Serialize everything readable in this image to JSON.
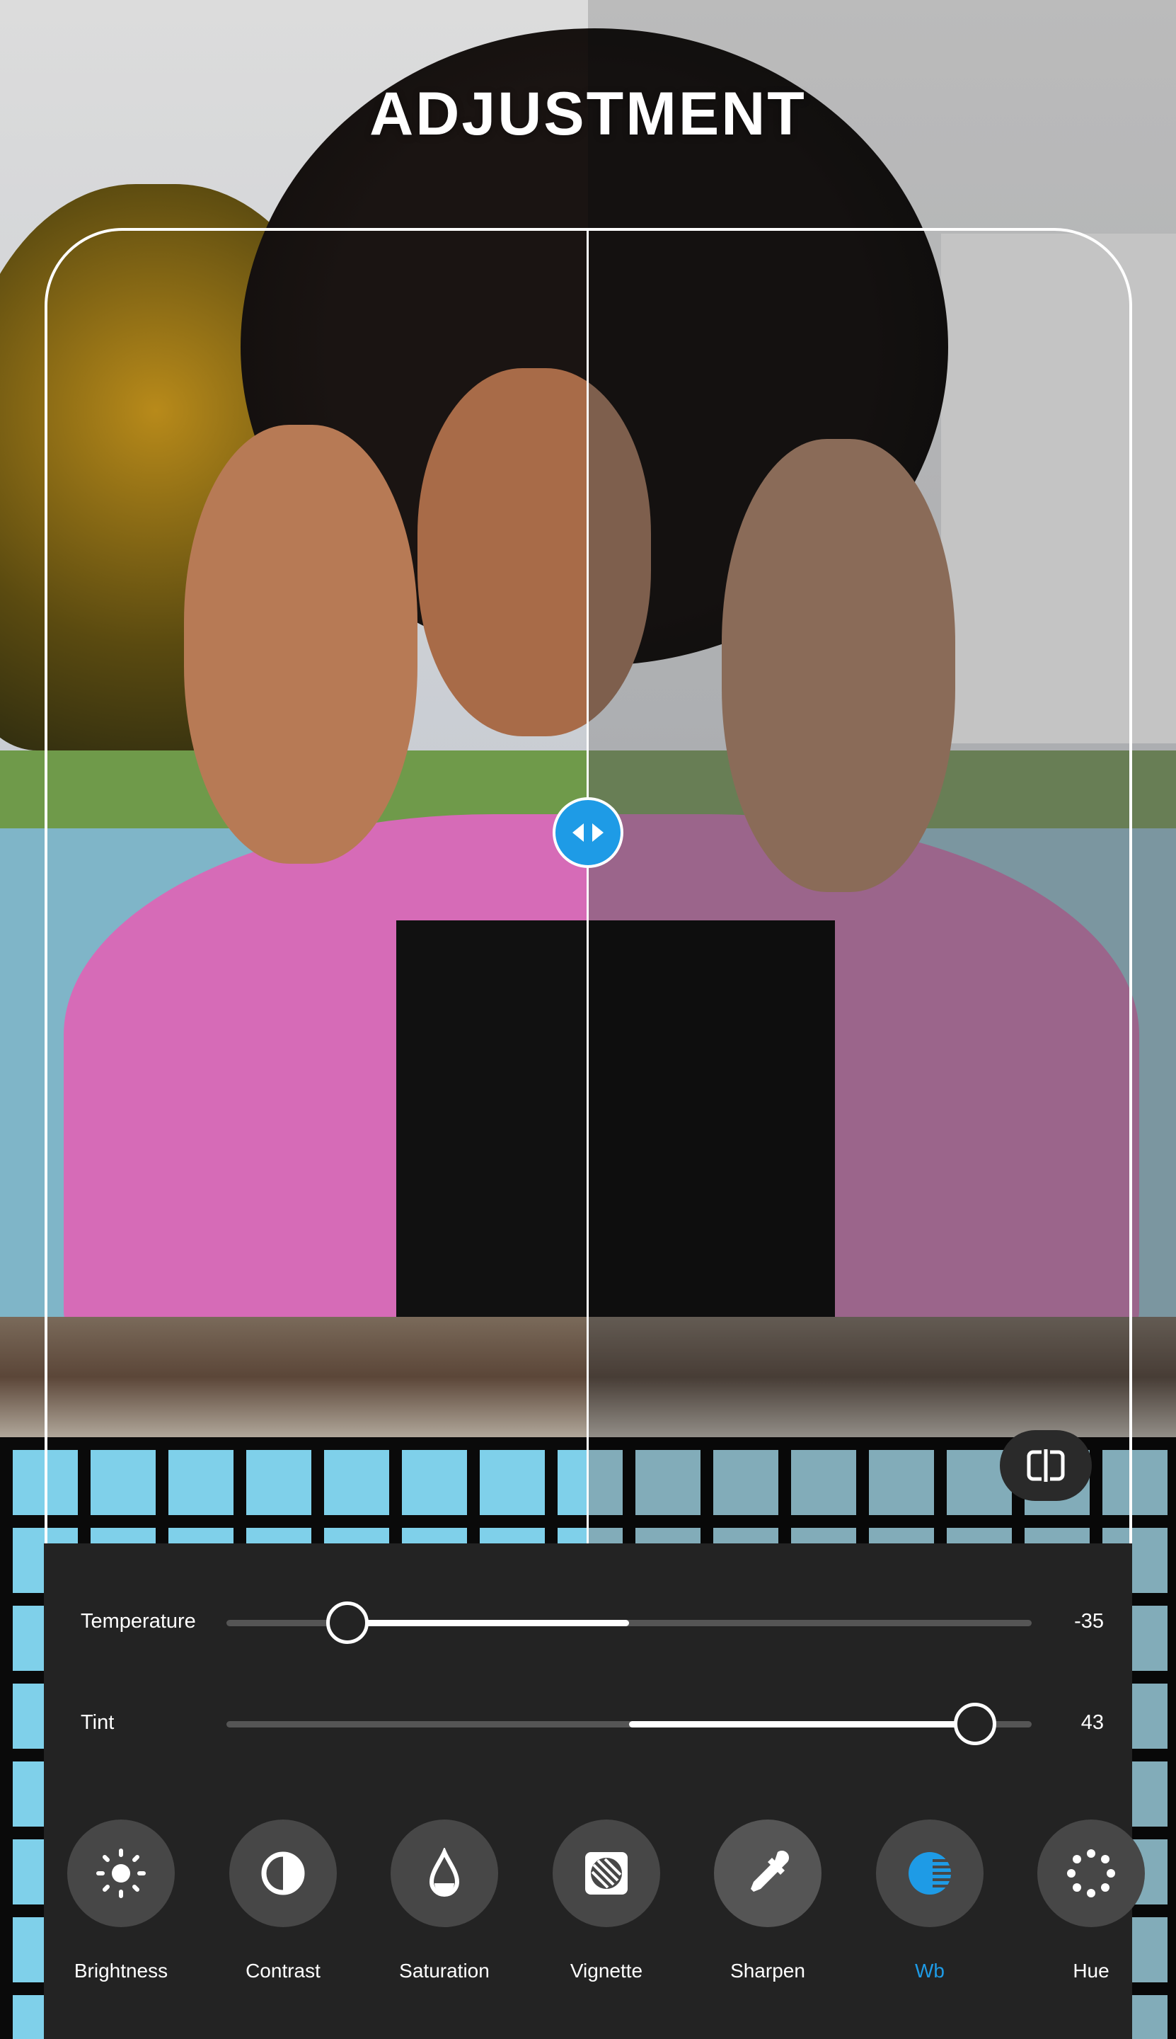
{
  "header": {
    "title": "ADJUSTMENT"
  },
  "compare": {
    "handle_icon": "left-right-arrows-icon",
    "compare_icon": "split-compare-icon"
  },
  "sliders": [
    {
      "label": "Temperature",
      "value": "-35",
      "numeric": -35,
      "min": -50,
      "max": 50
    },
    {
      "label": "Tint",
      "value": "43",
      "numeric": 43,
      "min": -50,
      "max": 50
    }
  ],
  "tools": [
    {
      "label": "Brightness",
      "icon": "sun-icon"
    },
    {
      "label": "Contrast",
      "icon": "contrast-icon"
    },
    {
      "label": "Saturation",
      "icon": "drop-icon"
    },
    {
      "label": "Vignette",
      "icon": "vignette-icon"
    },
    {
      "label": "Sharpen",
      "icon": "eyedropper-icon"
    },
    {
      "label": "Wb",
      "icon": "white-balance-icon",
      "active": true
    },
    {
      "label": "Hue",
      "icon": "hue-dots-icon"
    }
  ],
  "colors": {
    "accent": "#1e9be6",
    "panel": "#232323",
    "tool_bg": "#474747"
  }
}
